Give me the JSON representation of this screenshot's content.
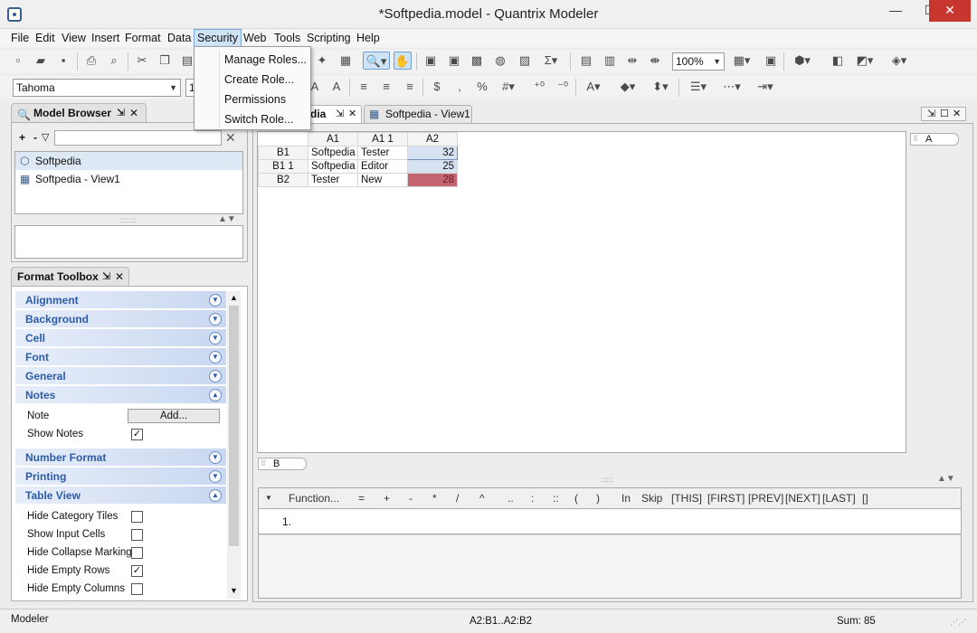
{
  "window": {
    "title": "*Softpedia.model - Quantrix Modeler",
    "minimize": "—",
    "maximize": "☐",
    "close": "✕"
  },
  "menu": [
    "File",
    "Edit",
    "View",
    "Insert",
    "Format",
    "Data",
    "Security",
    "Web",
    "Tools",
    "Scripting",
    "Help"
  ],
  "security_menu": [
    "Manage Roles...",
    "Create Role...",
    "Permissions",
    "Switch Role..."
  ],
  "toolbar": {
    "font": "Tahoma",
    "font_size": "1",
    "zoom": "100%"
  },
  "model_browser": {
    "title": "Model Browser",
    "add": "+",
    "remove": "-",
    "filter_icon": "▽",
    "clear": "✕",
    "items": [
      {
        "label": "Softpedia",
        "icon": "cube-icon"
      },
      {
        "label": "Softpedia - View1",
        "icon": "grid-icon"
      }
    ]
  },
  "format_toolbox": {
    "title": "Format Toolbox",
    "sections_top": [
      "Alignment",
      "Background",
      "Cell",
      "Font",
      "General",
      "Notes"
    ],
    "notes": {
      "note_label": "Note",
      "add_button": "Add...",
      "show_notes_label": "Show Notes",
      "show_notes": true
    },
    "sections_mid": [
      "Number Format",
      "Printing",
      "Table View"
    ],
    "table_view": [
      {
        "label": "Hide Category Tiles",
        "checked": false
      },
      {
        "label": "Show Input Cells",
        "checked": false
      },
      {
        "label": "Hide Collapse Marking",
        "checked": false
      },
      {
        "label": "Hide Empty Rows",
        "checked": true
      },
      {
        "label": "Hide Empty Columns",
        "checked": false
      }
    ]
  },
  "tabs": [
    {
      "label": "dia",
      "active": true
    },
    {
      "label": "Softpedia - View1",
      "active": false
    }
  ],
  "grid": {
    "col_headers": [
      "A1",
      "A1 1",
      "A2"
    ],
    "rows": [
      {
        "header": "B1",
        "a1": "Softpedia",
        "a11": "Tester",
        "a2": "32"
      },
      {
        "header": "B1 1",
        "a1": "Softpedia",
        "a11": "Editor",
        "a2": "25"
      },
      {
        "header": "B2",
        "a1": "Tester",
        "a11": "New",
        "a2": "28"
      }
    ],
    "category_a": "A",
    "category_b": "B",
    "colors": {
      "selected": "#d6e2f2",
      "highlight": "#c46470"
    }
  },
  "formula_bar": {
    "items": [
      "Function...",
      "=",
      "+",
      "-",
      "*",
      "/",
      "^",
      "..",
      ":",
      "::",
      "(",
      ")",
      "In",
      "Skip",
      "[THIS]",
      "[FIRST]",
      "[PREV]",
      "[NEXT]",
      "[LAST]",
      "[]"
    ],
    "line": "1."
  },
  "status": {
    "left": "Modeler",
    "center": "A2:B1..A2:B2",
    "right": "Sum: 85"
  }
}
